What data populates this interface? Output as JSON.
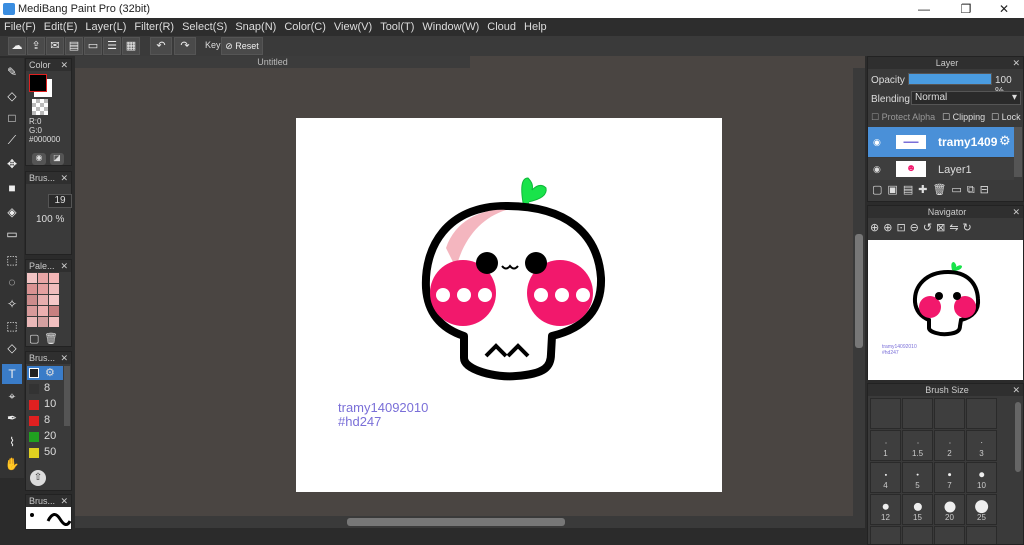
{
  "window": {
    "title": "MediBang Paint Pro (32bit)",
    "min": "—",
    "max": "❐",
    "close": "✕"
  },
  "menu": [
    "File(F)",
    "Edit(E)",
    "Layer(L)",
    "Filter(R)",
    "Select(S)",
    "Snap(N)",
    "Color(C)",
    "View(V)",
    "Tool(T)",
    "Window(W)",
    "Cloud",
    "Help"
  ],
  "toolbar": {
    "key_label": "Key",
    "reset_label": "Reset"
  },
  "color_panel": {
    "title": "Color",
    "r": "R:0",
    "g": "G:0",
    "hex": "#000000",
    "fg": "#000000",
    "bg": "#ffffff"
  },
  "brush_panel": {
    "title": "Brus...",
    "size": "19",
    "opacity": "100 %"
  },
  "palette_panel": {
    "title": "Pale..."
  },
  "brush_list": {
    "title": "Brus...",
    "items": [
      {
        "size": "8",
        "color": "#333333"
      },
      {
        "size": "10",
        "color": "#e02020"
      },
      {
        "size": "8",
        "color": "#e02020"
      },
      {
        "size": "20",
        "color": "#20a020"
      },
      {
        "size": "50",
        "color": "#e0d020"
      }
    ]
  },
  "brush_preview": {
    "title": "Brus..."
  },
  "document": {
    "tab": "Untitled",
    "text_line1": "tramy14092010",
    "text_line2": "#hd247",
    "text_color": "#7a6fd8"
  },
  "layer_panel": {
    "title": "Layer",
    "opacity_label": "Opacity",
    "opacity_value": "100 %",
    "opacity": 1.0,
    "blending_label": "Blending",
    "blending_value": "Normal",
    "protect_alpha": "Protect Alpha",
    "clipping": "Clipping",
    "lock": "Lock",
    "layers": [
      {
        "name": "tramy1409"
      },
      {
        "name": "Layer1"
      }
    ]
  },
  "navigator": {
    "title": "Navigator",
    "text_line1": "tramy14092010",
    "text_line2": "#hd247"
  },
  "brush_size": {
    "title": "Brush Size",
    "sizes": [
      "1",
      "1.5",
      "2",
      "3",
      "4",
      "5",
      "7",
      "10",
      "12",
      "15",
      "20",
      "25"
    ]
  }
}
